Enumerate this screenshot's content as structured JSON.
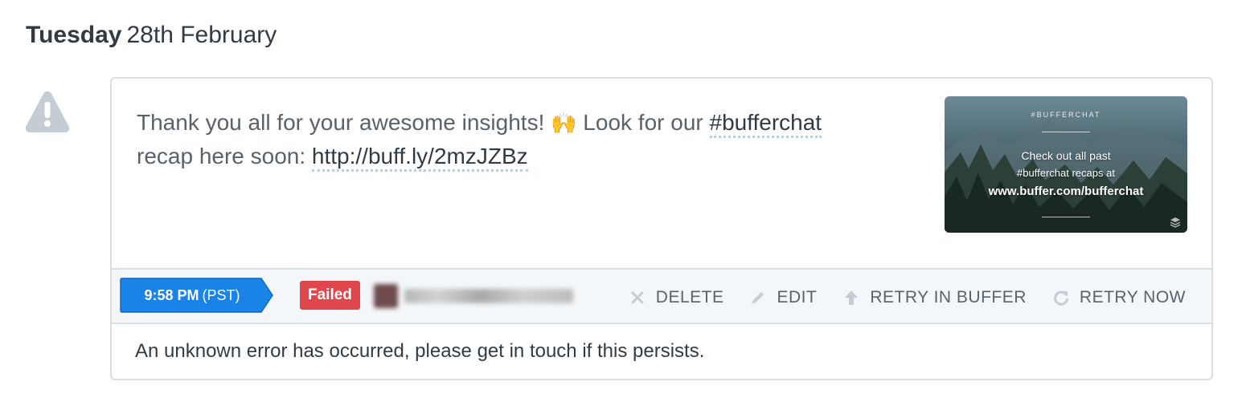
{
  "day": {
    "weekday": "Tuesday",
    "date": "28th February"
  },
  "post": {
    "text_before_emoji": "Thank you all for your awesome insights! ",
    "emoji": "🙌",
    "text_after_emoji": " Look for our ",
    "hashtag": "#bufferchat",
    "text_line2": "recap here soon: ",
    "link": "http://buff.ly/2mzJZBz",
    "thumbnail": {
      "tag": "#BUFFERCHAT",
      "line1": "Check out all past",
      "line2": "#bufferchat recaps at",
      "line3": "www.buffer.com/bufferchat"
    }
  },
  "footer": {
    "time": "9:58 PM",
    "timezone": "(PST)",
    "status": "Failed",
    "actions": {
      "delete": "DELETE",
      "edit": "EDIT",
      "retry_in_buffer": "RETRY IN BUFFER",
      "retry_now": "RETRY NOW"
    }
  },
  "error_message": "An unknown error has occurred, please get in touch if this persists.",
  "colors": {
    "time_tag": "#1a83e8",
    "failed_badge": "#e0474c",
    "warning_icon": "#c5ccd3"
  },
  "icons": {
    "warning": "warning-triangle-icon",
    "delete": "close-icon",
    "edit": "pencil-icon",
    "retry_in_buffer": "arrow-up-icon",
    "retry_now": "refresh-icon"
  }
}
